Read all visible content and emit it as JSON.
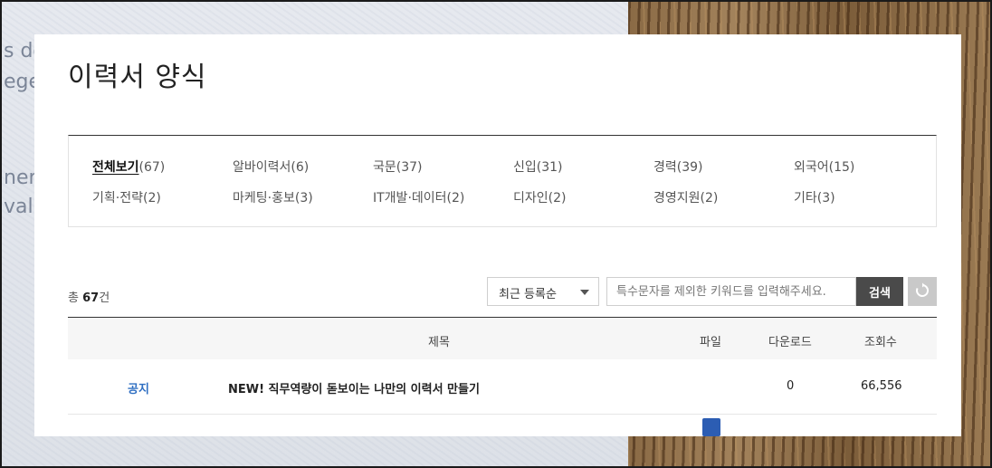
{
  "background": {
    "ghost_text": [
      "s do",
      "ege",
      "ner",
      "valli"
    ]
  },
  "page": {
    "title": "이력서 양식"
  },
  "categories": [
    {
      "name": "전체보기",
      "count": "(67)",
      "active": true
    },
    {
      "name": "알바이력서",
      "count": "(6)"
    },
    {
      "name": "국문",
      "count": "(37)"
    },
    {
      "name": "신입",
      "count": "(31)"
    },
    {
      "name": "경력",
      "count": "(39)"
    },
    {
      "name": "외국어",
      "count": "(15)"
    },
    {
      "name": "기획·전략",
      "count": "(2)"
    },
    {
      "name": "마케팅·홍보",
      "count": "(3)"
    },
    {
      "name": "IT개발·데이터",
      "count": "(2)"
    },
    {
      "name": "디자인",
      "count": "(2)"
    },
    {
      "name": "경영지원",
      "count": "(2)"
    },
    {
      "name": "기타",
      "count": "(3)"
    }
  ],
  "toolbar": {
    "total_prefix": "총 ",
    "total_count": "67",
    "total_suffix": "건",
    "sort_selected": "최근 등록순",
    "search_placeholder": "특수문자를 제외한 키워드를 입력해주세요.",
    "search_label": "검색"
  },
  "table": {
    "headers": {
      "title": "제목",
      "file": "파일",
      "downloads": "다운로드",
      "views": "조회수"
    },
    "rows": [
      {
        "tag": "공지",
        "title": "NEW! 직무역량이 돋보이는 나만의 이력서 만들기",
        "downloads": "0",
        "views": "66,556"
      }
    ]
  },
  "colors": {
    "notice_blue": "#2f6fc2",
    "search_button": "#4a4a4a",
    "reset_button": "#c9c9c9"
  }
}
